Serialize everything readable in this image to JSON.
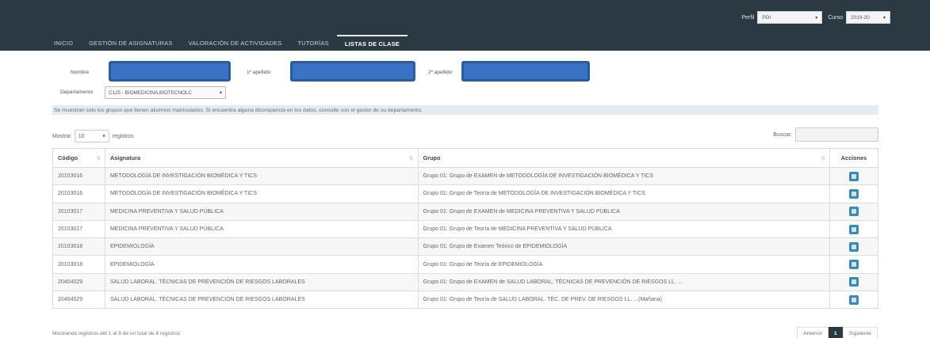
{
  "header": {
    "perfil_label": "Perfil",
    "perfil_value": "PDI",
    "curso_label": "Curso",
    "curso_value": "2019-20"
  },
  "nav": {
    "tabs": [
      {
        "label": "INICIO",
        "active": false
      },
      {
        "label": "GESTIÓN DE ASIGNATURAS",
        "active": false
      },
      {
        "label": "VALORACIÓN DE ACTIVIDADES",
        "active": false
      },
      {
        "label": "TUTORÍAS",
        "active": false
      },
      {
        "label": "LISTAS DE CLASE",
        "active": true
      }
    ]
  },
  "filters": {
    "nombre_label": "Nombre",
    "apellido1_label": "1º apellido",
    "apellido2_label": "2º apellido",
    "departamento_label": "Departamento",
    "departamento_value": "C125 - BIOMEDICINA,BIOTECNOLC"
  },
  "notice": "Se muestran solo los grupos que tienen alumnos matriculados. Si encuentra alguna discrepancia en los datos, consulte con el gestor de su departamento.",
  "length": {
    "mostrar_label": "Mostrar",
    "value": "10",
    "registros_label": "registros"
  },
  "search": {
    "label": "Buscar:"
  },
  "table": {
    "headers": [
      "Código",
      "Asignatura",
      "Grupo",
      "Acciones"
    ],
    "rows": [
      [
        "20103016",
        "METODOLOGÍA DE INVESTIGACIÓN BIOMÉDICA Y TICS",
        "Grupo 01: Grupo de EXAMEN de METODOLOGÍA DE INVESTIGACIÓN BIOMÉDICA Y TICS"
      ],
      [
        "20103016",
        "METODOLOGÍA DE INVESTIGACIÓN BIOMÉDICA Y TICS",
        "Grupo 01: Grupo de Teoría de METODOLOGÍA DE INVESTIGACIÓN BIOMÉDICA Y TICS"
      ],
      [
        "20103017",
        "MEDICINA PREVENTIVA Y SALUD PÚBLICA",
        "Grupo 01: Grupo de EXAMEN de MEDICINA PREVENTIVA Y SALUD PÚBLICA"
      ],
      [
        "20103017",
        "MEDICINA PREVENTIVA Y SALUD PÚBLICA",
        "Grupo 01: Grupo de Teoría de MEDICINA PREVENTIVA Y SALUD PÚBLICA"
      ],
      [
        "20103018",
        "EPIDEMIOLOGÍA",
        "Grupo 01: Grupo de Examen Teórico de EPIDEMIOLOGÍA"
      ],
      [
        "20103018",
        "EPIDEMIOLOGÍA",
        "Grupo 01: Grupo de Teoría de EPIDEMIOLOGÍA"
      ],
      [
        "20404029",
        "SALUD LABORAL. TÉCNICAS DE PREVENCIÓN DE RIESGOS LABORALES",
        "Grupo 01: Grupo de EXAMEN de SALUD LABORAL. TÉCNICAS DE PREVENCIÓN DE RIESGOS LL. ..."
      ],
      [
        "20404029",
        "SALUD LABORAL. TÉCNICAS DE PREVENCIÓN DE RIESGOS LABORALES",
        "Grupo 01: Grupo de Teoría de SALUD LABORAL. TÉC. DE PREV. DE RIESGOS LL. ...(Mañana)"
      ]
    ]
  },
  "footer": {
    "info": "Mostrando registros del 1 al 8 de un total de 8 registros",
    "prev": "Anterior",
    "page": "1",
    "next": "Siguiente"
  },
  "icons": {
    "row_action": "list-icon",
    "sort": "sort-icon"
  },
  "colors": {
    "header_bg": "#2b3a42",
    "redaction": "#3a73c5",
    "action_button": "#3a8ab8",
    "notice_bg": "#e3ecf1"
  }
}
